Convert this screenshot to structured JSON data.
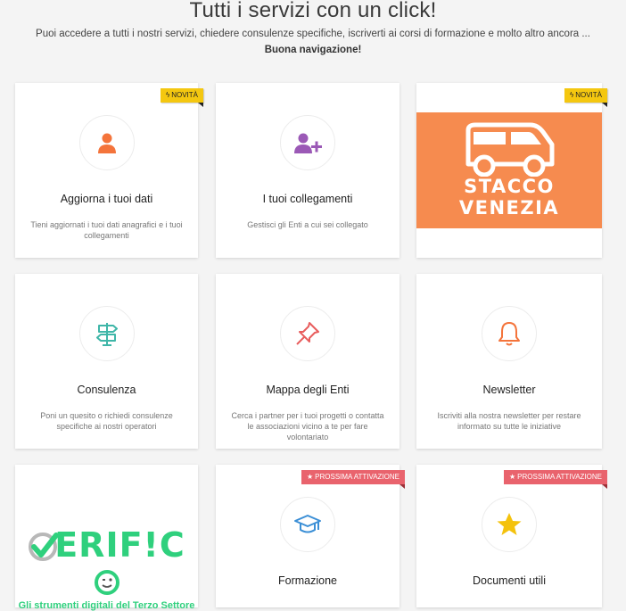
{
  "header": {
    "title": "Tutti i servizi con un click!",
    "subtitle": "Puoi accedere a tutti i nostri servizi, chiedere consulenze specifiche, iscriverti ai corsi di formazione e molto altro ancora ...",
    "bold": "Buona navigazione!"
  },
  "badges": {
    "new": "NOVITÀ",
    "soon": "PROSSIMA ATTIVAZIONE"
  },
  "cards": [
    {
      "title": "Aggiorna i tuoi dati",
      "desc": "Tieni aggiornati i tuoi dati anagrafici e i tuoi collegamenti",
      "icon": "user-icon",
      "color": "#f4743b"
    },
    {
      "title": "I tuoi collegamenti",
      "desc": "Gestisci gli Enti a cui sei collegato",
      "icon": "user-plus-icon",
      "color": "#9b59b6"
    },
    {
      "title": "STACCO VENEZIA",
      "color": "#f68b4f"
    },
    {
      "title": "Consulenza",
      "desc": "Poni un quesito o richiedi consulenze specifiche ai nostri operatori",
      "icon": "signpost-icon",
      "color": "#3fb6a8"
    },
    {
      "title": "Mappa degli Enti",
      "desc": "Cerca i partner per i tuoi progetti o contatta le associazioni vicino a te per fare volontariato",
      "icon": "pin-icon",
      "color": "#e85d5d"
    },
    {
      "title": "Newsletter",
      "desc": "Iscriviti alla nostra newsletter per restare informato su tutte le iniziative",
      "icon": "bell-icon",
      "color": "#f4743b"
    },
    {
      "logo": "VERIFICO",
      "tag": "Gli strumenti digitali del Terzo Settore",
      "color": "#2fd07d"
    },
    {
      "title": "Formazione",
      "icon": "graduation-cap-icon",
      "color": "#3b8fd6"
    },
    {
      "title": "Documenti utili",
      "icon": "star-icon",
      "color": "#f4c20d"
    }
  ]
}
